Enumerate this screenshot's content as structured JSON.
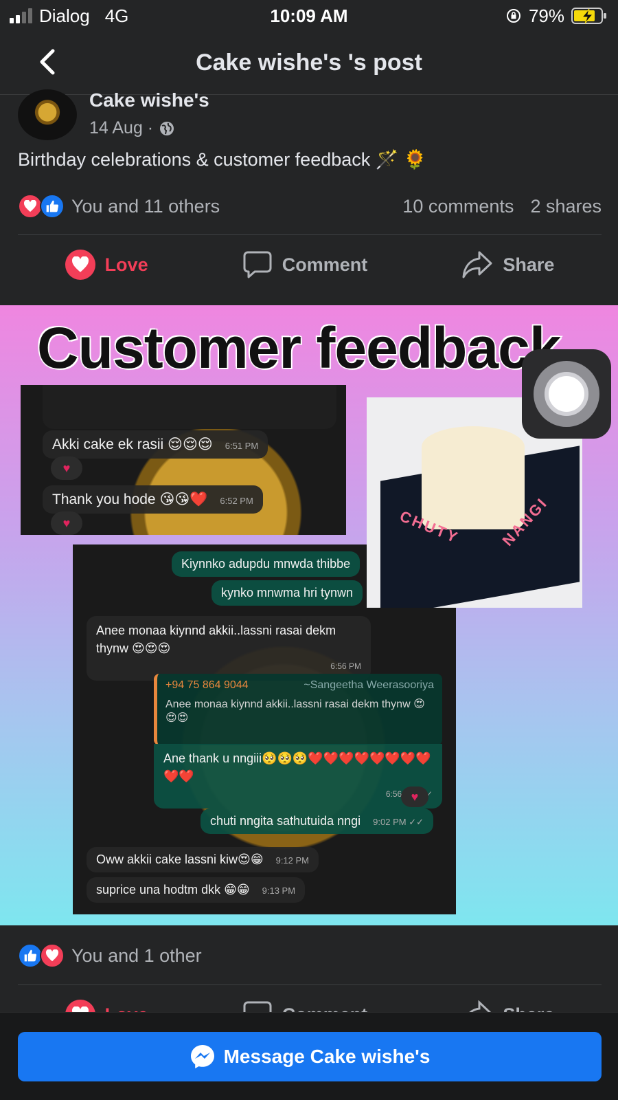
{
  "status": {
    "carrier": "Dialog",
    "network": "4G",
    "time": "10:09 AM",
    "battery": "79%"
  },
  "nav": {
    "title": "Cake wishe's 's post"
  },
  "post": {
    "author": "Cake wishe's",
    "date": "14 Aug ·",
    "caption": "Birthday celebrations & customer feedback 🪄 🌻",
    "reactions_text": "You and 11 others",
    "comments": "10 comments",
    "shares": "2 shares",
    "love_label": "Love",
    "comment_label": "Comment",
    "share_label": "Share"
  },
  "image": {
    "title": "Customer feedback",
    "chat1": {
      "msg1": "Akki cake ek rasii 😌😌😌",
      "time1": "6:51 PM",
      "msg2": "Thank you hode 😘😘❤️",
      "time2": "6:52 PM"
    },
    "chat2": {
      "out1": "Kiynnko adupdu mnwda thibbe",
      "out2": "kynko mnwma hri tynwn",
      "in1": "Anee monaa kiynnd akkii..lassni rasai dekm thynw 😍😍😍",
      "in1_time": "6:56 PM",
      "quote_phone": "+94 75 864 9044",
      "quote_name": "~Sangeetha Weerasooriya",
      "quote_text": "Anee monaa kiynnd akkii..lassni rasai dekm thynw 😍😍😍",
      "reply": "Ane thank u nngiii🥺🥺🥺❤️❤️❤️❤️❤️❤️❤️❤️❤️❤️",
      "reply_time": "6:56 PM ✓✓",
      "out3": "chuti nngita sathutuida nngi",
      "out3_time": "9:02 PM ✓✓",
      "in2": "Oww akkii cake lassni kiw😍😁",
      "in2_time": "9:12 PM",
      "in3": "suprice una hodtm dkk 😁😁",
      "in3_time": "9:13 PM"
    },
    "cake_text_1": "CHUTY",
    "cake_text_2": "NANGI"
  },
  "post2": {
    "reactions_text": "You and 1 other",
    "love_label": "Love",
    "comment_label": "Comment",
    "share_label": "Share"
  },
  "footer": {
    "message_label": "Message Cake wishe's"
  }
}
